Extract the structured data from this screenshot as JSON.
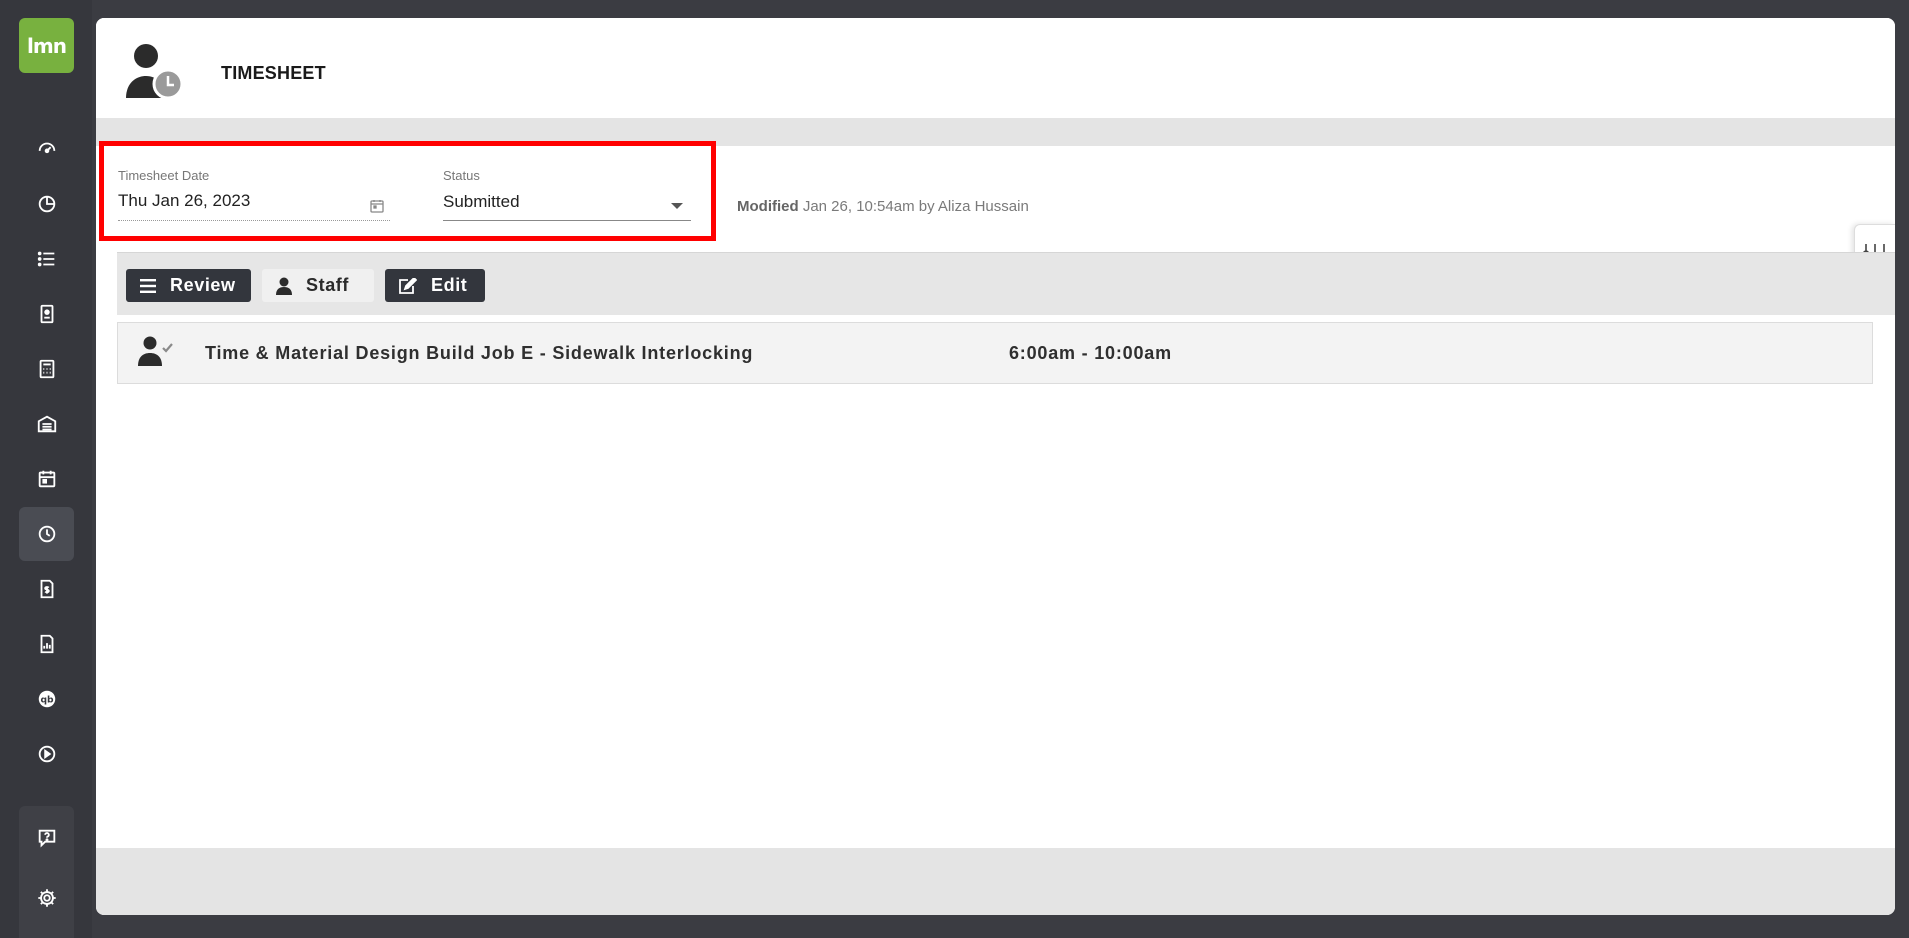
{
  "app": {
    "logo_text": "lmn",
    "brand_color": "#78b13f"
  },
  "sidebar": {
    "items": [
      {
        "name": "dashboard-icon"
      },
      {
        "name": "pie-chart-icon"
      },
      {
        "name": "list-icon"
      },
      {
        "name": "contact-card-icon"
      },
      {
        "name": "calculator-icon"
      },
      {
        "name": "garage-icon"
      },
      {
        "name": "calendar-icon"
      },
      {
        "name": "clock-icon",
        "active": true
      },
      {
        "name": "invoice-icon"
      },
      {
        "name": "report-icon"
      },
      {
        "name": "quickbooks-icon"
      },
      {
        "name": "play-icon"
      }
    ],
    "bottom_items": [
      {
        "name": "help-icon"
      },
      {
        "name": "gear-icon"
      }
    ]
  },
  "header": {
    "title": "TIMESHEET"
  },
  "filters": {
    "date_label": "Timesheet Date",
    "date_value": "Thu Jan 26, 2023",
    "status_label": "Status",
    "status_value": "Submitted"
  },
  "modified": {
    "label": "Modified",
    "text": "Jan 26, 10:54am by Aliza Hussain"
  },
  "toolbar": {
    "review_label": "Review",
    "staff_label": "Staff",
    "edit_label": "Edit"
  },
  "jobs": [
    {
      "title": "Time & Material Design Build Job E - Sidewalk Interlocking",
      "time": "6:00am - 10:00am"
    }
  ],
  "colors": {
    "highlight": "#ff0000",
    "button_dark": "#33363d",
    "sidebar_bg": "#36373d"
  }
}
